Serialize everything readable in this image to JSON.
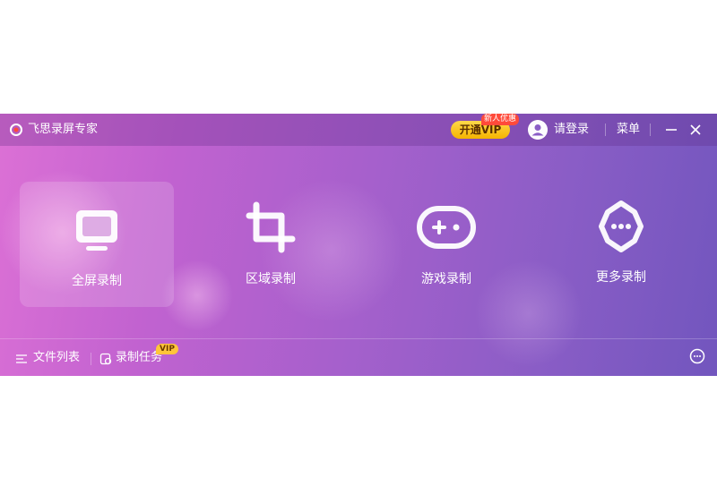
{
  "titlebar": {
    "app_title": "飞思录屏专家",
    "vip_button": "开通VIP",
    "vip_badge": "新人优惠",
    "login": "请登录",
    "menu": "菜单"
  },
  "modes": [
    {
      "label": "全屏录制",
      "icon": "monitor-icon",
      "active": true
    },
    {
      "label": "区域录制",
      "icon": "crop-icon",
      "active": false
    },
    {
      "label": "游戏录制",
      "icon": "gamepad-icon",
      "active": false
    },
    {
      "label": "更多录制",
      "icon": "more-icon",
      "active": false
    }
  ],
  "bottombar": {
    "file_list": "文件列表",
    "record_task": "录制任务",
    "record_task_badge": "VIP"
  },
  "colors": {
    "accent_vip": "#f5b400",
    "badge_red": "#ff4a3a"
  }
}
